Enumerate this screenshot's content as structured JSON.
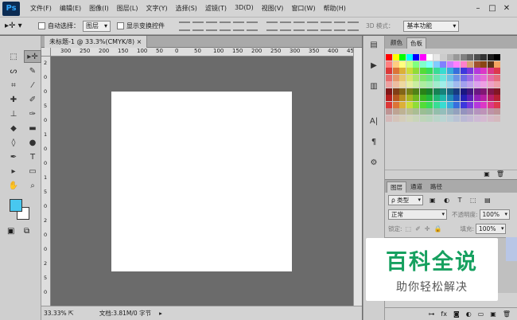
{
  "app": {
    "logo": "Ps"
  },
  "menu": [
    "文件(F)",
    "编辑(E)",
    "图像(I)",
    "图层(L)",
    "文字(Y)",
    "选择(S)",
    "滤镜(T)",
    "3D(D)",
    "视图(V)",
    "窗口(W)",
    "帮助(H)"
  ],
  "window_controls": [
    "–",
    "□",
    "✕"
  ],
  "options": {
    "auto_select_label": "自动选择：",
    "auto_select_value": "图层",
    "show_transform_label": "显示变换控件",
    "mode_3d_label": "3D 模式：",
    "workspace_value": "基本功能"
  },
  "document": {
    "tab_title": "未标题-1 @ 33.3%(CMYK/8)",
    "zoom": "33.33%",
    "doc_info": "文档:3.81M/0 字节"
  },
  "ruler_h_ticks": [
    "300",
    "250",
    "200",
    "150",
    "100",
    "50",
    "0",
    "50",
    "100",
    "150",
    "200",
    "250",
    "300",
    "350",
    "400",
    "450"
  ],
  "ruler_v_ticks": [
    "2",
    "0",
    "0",
    "5",
    "0",
    "1",
    "0",
    "0",
    "1",
    "5",
    "0",
    "2",
    "0",
    "0",
    "2",
    "5",
    "0"
  ],
  "panels": {
    "color_tab": "颜色",
    "swatches_tab": "色板",
    "layers_tab": "图层",
    "channels_tab": "通道",
    "paths_tab": "路径",
    "filter_kind": "ρ 类型",
    "blend_mode": "正常",
    "opacity_label": "不透明度:",
    "opacity_value": "100%",
    "lock_label": "锁定:",
    "fill_label": "填充:",
    "fill_value": "100%"
  },
  "watermark": {
    "title": "百科全说",
    "subtitle": "助你轻松解决"
  },
  "colors": {
    "foreground": "#48c8f0",
    "background": "#ffffff",
    "watermark_green": "#16a05f"
  }
}
